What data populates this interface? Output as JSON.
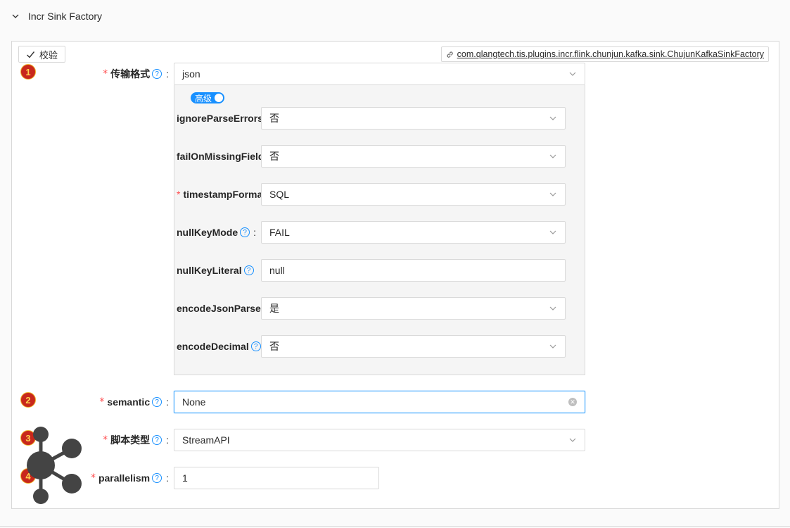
{
  "panel": {
    "title": "Incr Sink Factory"
  },
  "toolbar": {
    "validate_label": "校验",
    "plugin_link": "com.qlangtech.tis.plugins.incr.flink.chunjun.kafka.sink.ChujunKafkaSinkFactory"
  },
  "badges": [
    "1",
    "2",
    "3",
    "4"
  ],
  "form": {
    "format": {
      "label": "传输格式",
      "value": "json"
    },
    "advanced_toggle": "高级",
    "json_options": [
      {
        "label": "ignoreParseErrors",
        "value": "否",
        "required": false,
        "help": false,
        "kind": "select"
      },
      {
        "label": "failOnMissingField",
        "value": "否",
        "required": false,
        "help": false,
        "kind": "select"
      },
      {
        "label": "timestampFormat",
        "value": "SQL",
        "required": true,
        "help": false,
        "kind": "select"
      },
      {
        "label": "nullKeyMode",
        "value": "FAIL",
        "required": false,
        "help": true,
        "kind": "select"
      },
      {
        "label": "nullKeyLiteral",
        "value": "null",
        "required": false,
        "help": true,
        "kind": "input"
      },
      {
        "label": "encodeJsonParserEnabled",
        "value": "是",
        "required": false,
        "help": false,
        "kind": "select"
      },
      {
        "label": "encodeDecimal",
        "value": "否",
        "required": false,
        "help": true,
        "kind": "select"
      }
    ],
    "semantic": {
      "label": "semantic",
      "value": "None"
    },
    "script_type": {
      "label": "脚本类型",
      "value": "StreamAPI"
    },
    "parallelism": {
      "label": "parallelism",
      "value": "1"
    }
  },
  "colors": {
    "accent": "#1890ff",
    "required": "#ff4d4f",
    "badge": "#c8281c",
    "border": "#d9d9d9"
  }
}
